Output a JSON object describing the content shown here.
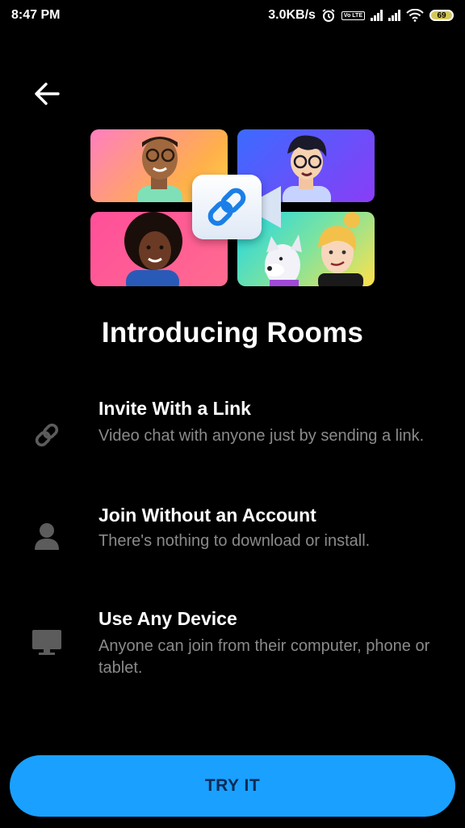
{
  "status_bar": {
    "time": "8:47 PM",
    "network_speed": "3.0KB/s",
    "lte_label": "Vo LTE",
    "battery_level": "69",
    "icons": [
      "alarm-icon",
      "signal-icon",
      "signal-icon",
      "wifi-icon",
      "battery-icon"
    ]
  },
  "nav": {
    "back_icon": "back-arrow-icon"
  },
  "hero": {
    "icon": "link-icon",
    "tiles": [
      "person-glasses-tile",
      "person-curly-hair-tile",
      "person-afro-tile",
      "dog-and-person-tile"
    ]
  },
  "title": "Introducing Rooms",
  "features": [
    {
      "icon": "link-icon",
      "heading": "Invite With a Link",
      "description": "Video chat with anyone just by sending a link."
    },
    {
      "icon": "person-icon",
      "heading": "Join Without an Account",
      "description": "There's nothing to download or install."
    },
    {
      "icon": "monitor-icon",
      "heading": "Use Any Device",
      "description": "Anyone can join from their computer, phone or tablet."
    }
  ],
  "cta": {
    "label": "TRY IT"
  },
  "colors": {
    "background": "#000000",
    "button": "#1aa0ff",
    "muted_text": "#8a8a8a"
  }
}
